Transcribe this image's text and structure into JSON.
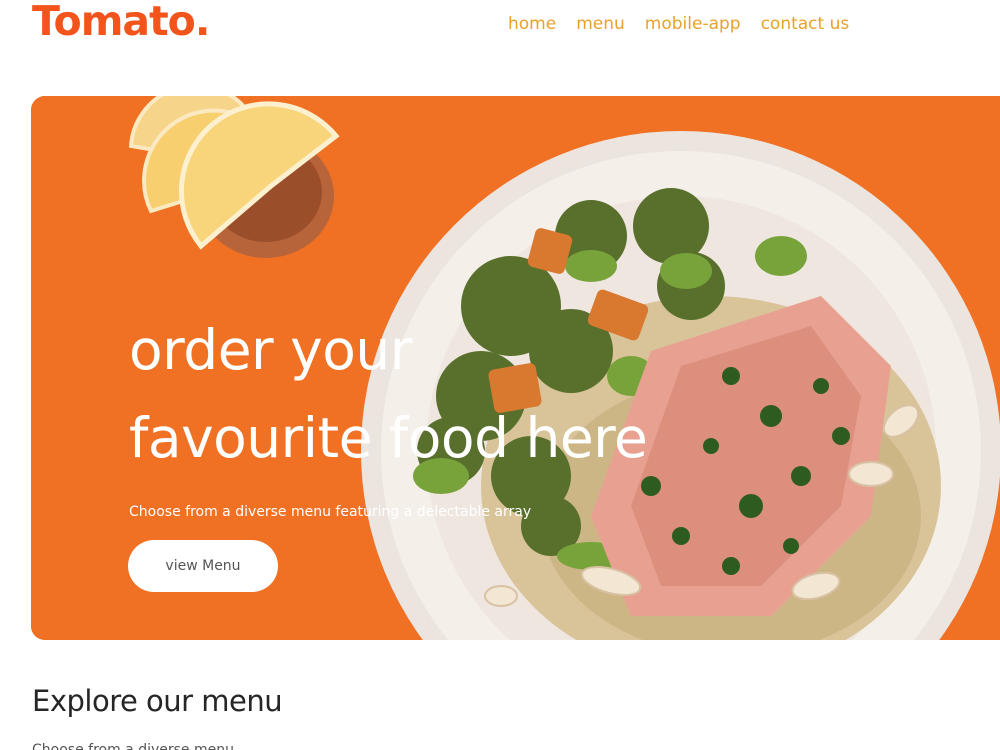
{
  "brand": {
    "logo": "Tomato.",
    "accent": "#f2541b",
    "nav_color": "#e9a12b",
    "hero_bg": "#f07124"
  },
  "nav": {
    "links": [
      {
        "label": "home"
      },
      {
        "label": "menu"
      },
      {
        "label": "mobile-app"
      },
      {
        "label": "contact us"
      }
    ]
  },
  "hero": {
    "title_line1": "order your",
    "title_line2": "favourite food here",
    "description": "Choose from a diverse menu featuring a delectable array",
    "button_label": "view Menu",
    "image_icon": "food-plate-illustration"
  },
  "explore": {
    "title": "Explore our menu",
    "subtitle": "Choose from a diverse menu"
  }
}
